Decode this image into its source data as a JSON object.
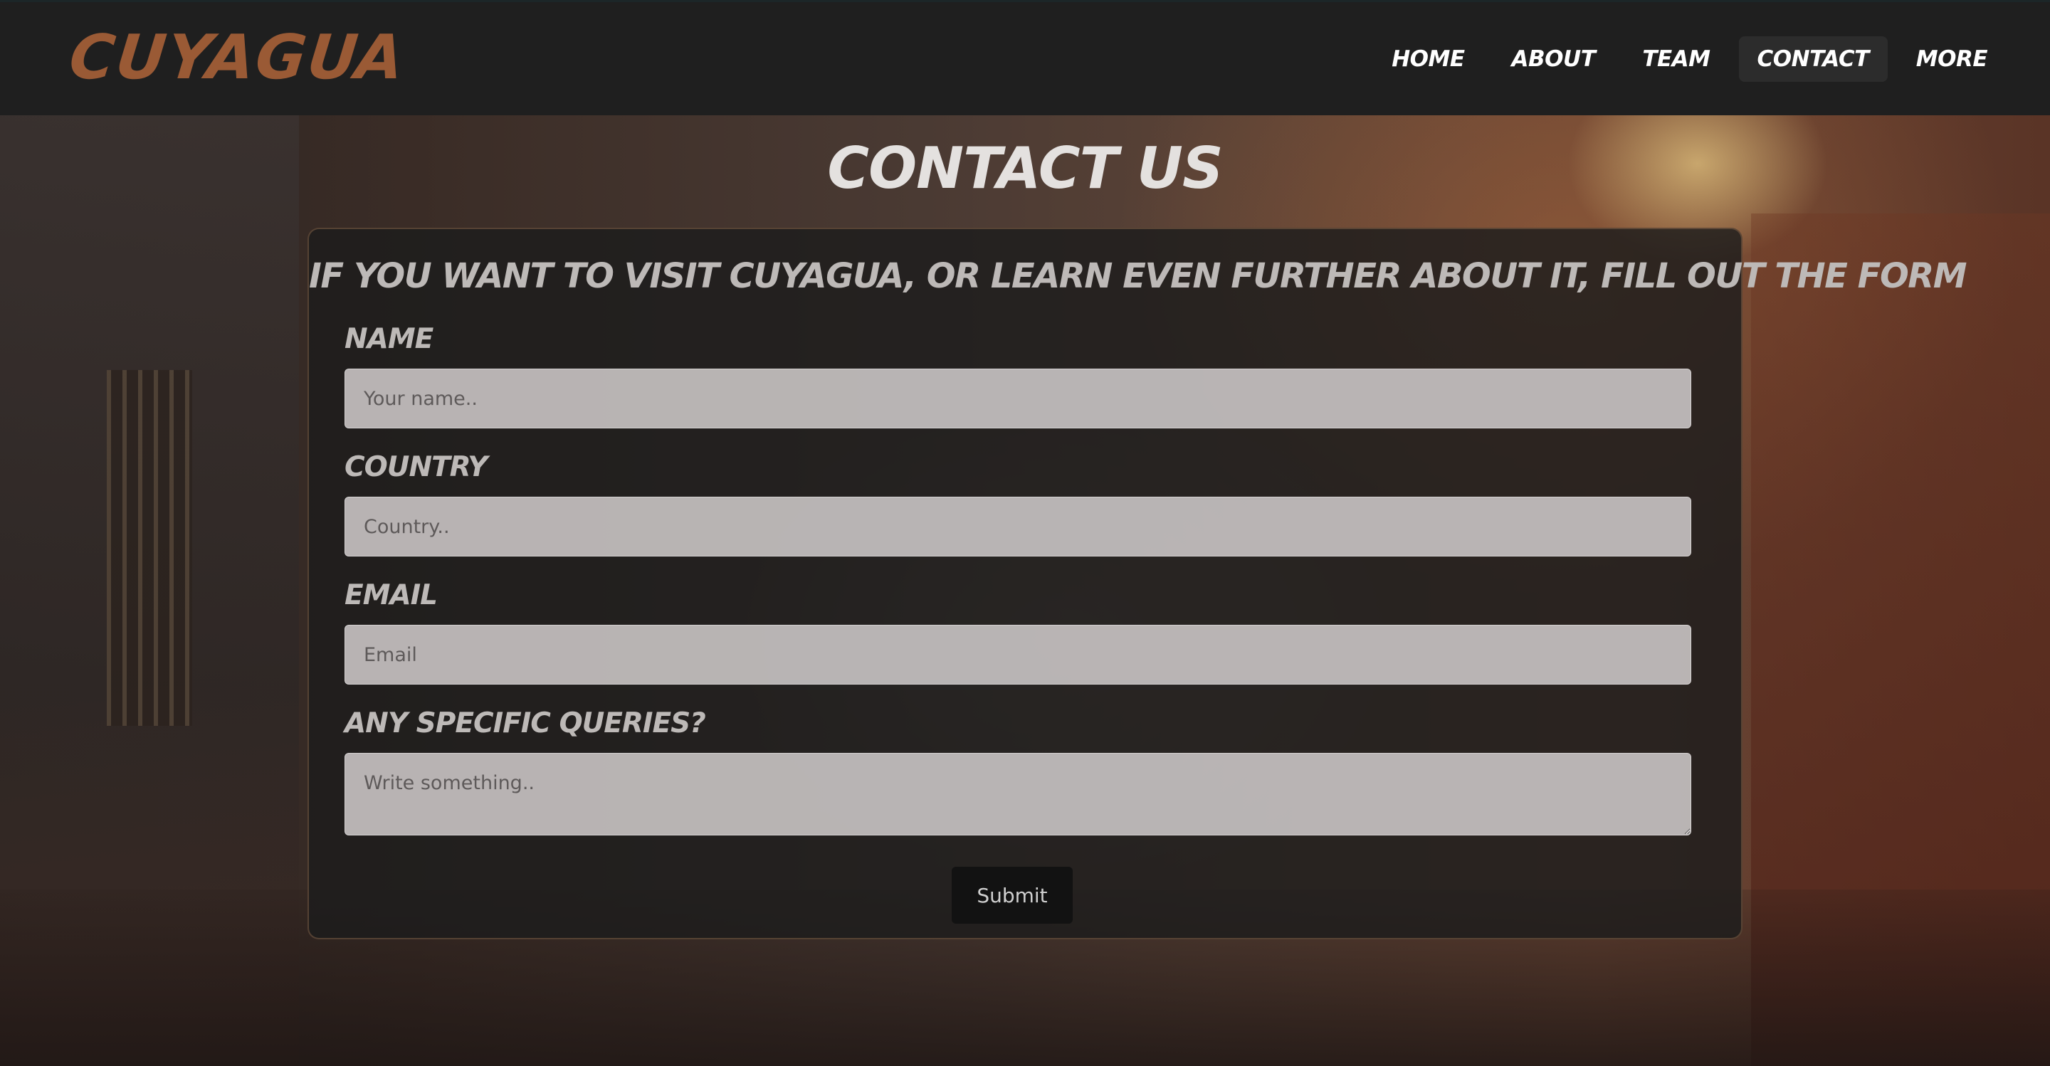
{
  "site": {
    "logo": "CUYAGUA"
  },
  "nav": {
    "items": [
      {
        "label": "HOME",
        "active": false
      },
      {
        "label": "ABOUT",
        "active": false
      },
      {
        "label": "TEAM",
        "active": false
      },
      {
        "label": "CONTACT",
        "active": true
      },
      {
        "label": "MORE",
        "active": false
      }
    ]
  },
  "page": {
    "title": "CONTACT US"
  },
  "form": {
    "heading": "IF YOU WANT TO VISIT CUYAGUA, OR LEARN EVEN FURTHER ABOUT IT, FILL OUT THE FORM",
    "name_label": "NAME",
    "name_placeholder": "Your name..",
    "name_value": "",
    "country_label": "COUNTRY",
    "country_placeholder": "Country..",
    "country_value": "",
    "email_label": "EMAIL",
    "email_placeholder": "Email",
    "email_value": "",
    "queries_label": "ANY SPECIFIC QUERIES?",
    "queries_placeholder": "Write something..",
    "queries_value": "",
    "submit_label": "Submit"
  },
  "colors": {
    "logo": "#9a5a35",
    "header_bg": "#1f1f1f",
    "panel_bg": "#1c1c1c",
    "field_bg": "#cdc8c8",
    "submit_bg": "#121212"
  }
}
